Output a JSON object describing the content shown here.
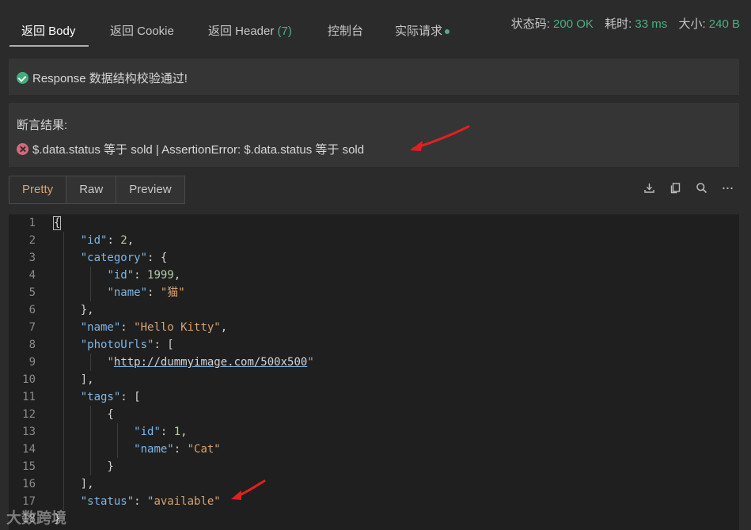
{
  "tabs": [
    {
      "label": "返回 Body",
      "active": true
    },
    {
      "label": "返回 Cookie",
      "active": false
    },
    {
      "label": "返回 Header",
      "count": "(7)",
      "active": false
    },
    {
      "label": "控制台",
      "active": false
    },
    {
      "label": "实际请求",
      "active": false
    }
  ],
  "status": {
    "code_label": "状态码:",
    "code_value": "200 OK",
    "time_label": "耗时:",
    "time_value": "33 ms",
    "size_label": "大小:",
    "size_value": "240 B"
  },
  "validation": {
    "message": "Response 数据结构校验通过!"
  },
  "assertion": {
    "title": "断言结果:",
    "message": "$.data.status 等于 sold | AssertionError: $.data.status 等于 sold"
  },
  "view_modes": [
    "Pretty",
    "Raw",
    "Preview"
  ],
  "active_view": "Pretty",
  "toolbar_icons": [
    "download-icon",
    "copy-icon",
    "search-icon",
    "more-icon"
  ],
  "code_lines": [
    {
      "n": "1",
      "html_key": "l1"
    },
    {
      "n": "2"
    },
    {
      "n": "3"
    },
    {
      "n": "4"
    },
    {
      "n": "5"
    },
    {
      "n": "6"
    },
    {
      "n": "7"
    },
    {
      "n": "8"
    },
    {
      "n": "9"
    },
    {
      "n": "10"
    },
    {
      "n": "11"
    },
    {
      "n": "12"
    },
    {
      "n": "13"
    },
    {
      "n": "14"
    },
    {
      "n": "15"
    },
    {
      "n": "16"
    },
    {
      "n": "17"
    },
    {
      "n": "18"
    }
  ],
  "json": {
    "id_key": "\"id\"",
    "id_val": "2",
    "category_key": "\"category\"",
    "cat_id_key": "\"id\"",
    "cat_id_val": "1999",
    "cat_name_key": "\"name\"",
    "cat_name_val": "\"猫\"",
    "name_key": "\"name\"",
    "name_val": "\"Hello Kitty\"",
    "photo_key": "\"photoUrls\"",
    "photo_url": "http://dummyimage.com/500x500",
    "tags_key": "\"tags\"",
    "tag_id_key": "\"id\"",
    "tag_id_val": "1",
    "tag_name_key": "\"name\"",
    "tag_name_val": "\"Cat\"",
    "status_key": "\"status\"",
    "status_val": "\"available\""
  },
  "watermark": "大数跨境",
  "colors": {
    "accent_green": "#4caf82",
    "active_view": "#d9a273",
    "error": "#d16a7c",
    "arrow": "#e02020"
  }
}
